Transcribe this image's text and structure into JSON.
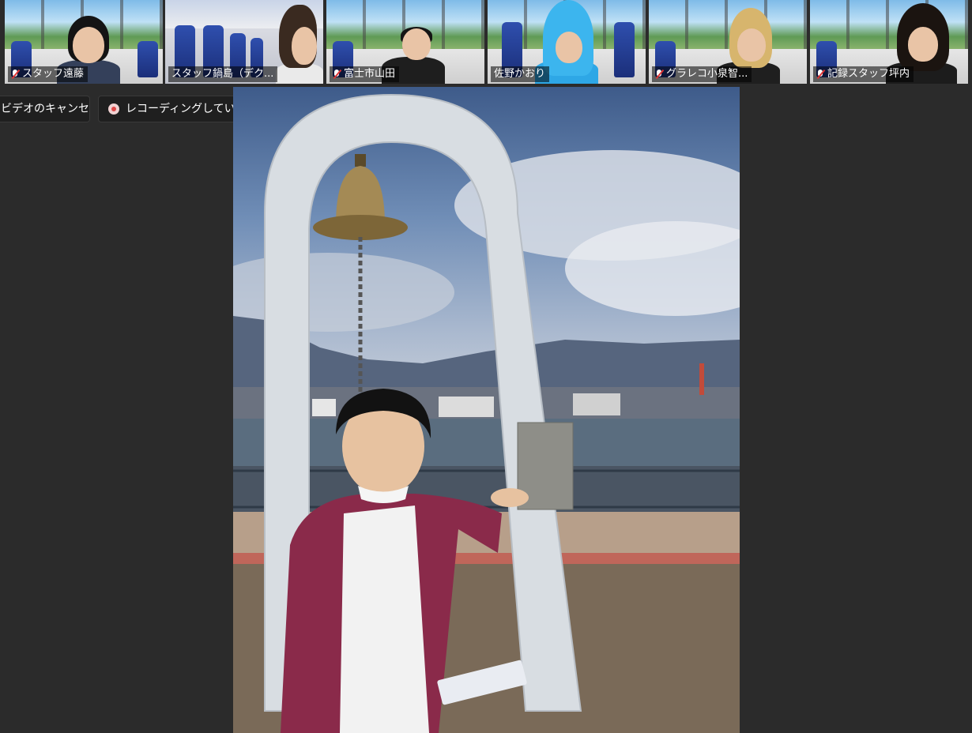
{
  "participants": [
    {
      "name": "スタッフ遠藤",
      "muted": true,
      "background": "train-window"
    },
    {
      "name": "スタッフ鍋島（デク...",
      "muted": false,
      "background": "train-interior"
    },
    {
      "name": "富士市山田",
      "muted": true,
      "background": "train-window"
    },
    {
      "name": "佐野かおり",
      "muted": false,
      "background": "train-window"
    },
    {
      "name": "グラレコ小泉智...",
      "muted": true,
      "background": "train-window"
    },
    {
      "name": "記録スタッフ坪内",
      "muted": true,
      "background": "train-window"
    }
  ],
  "toolbar": {
    "cancel_video_label": "ビデオのキャンセル",
    "recording_label": "レコーディングしています..."
  },
  "main_video": {
    "description_icon": "bell-monument-video"
  },
  "colors": {
    "background": "#2b2b2b",
    "muted_icon": "#e03535",
    "recording_dot": "#e04848"
  }
}
